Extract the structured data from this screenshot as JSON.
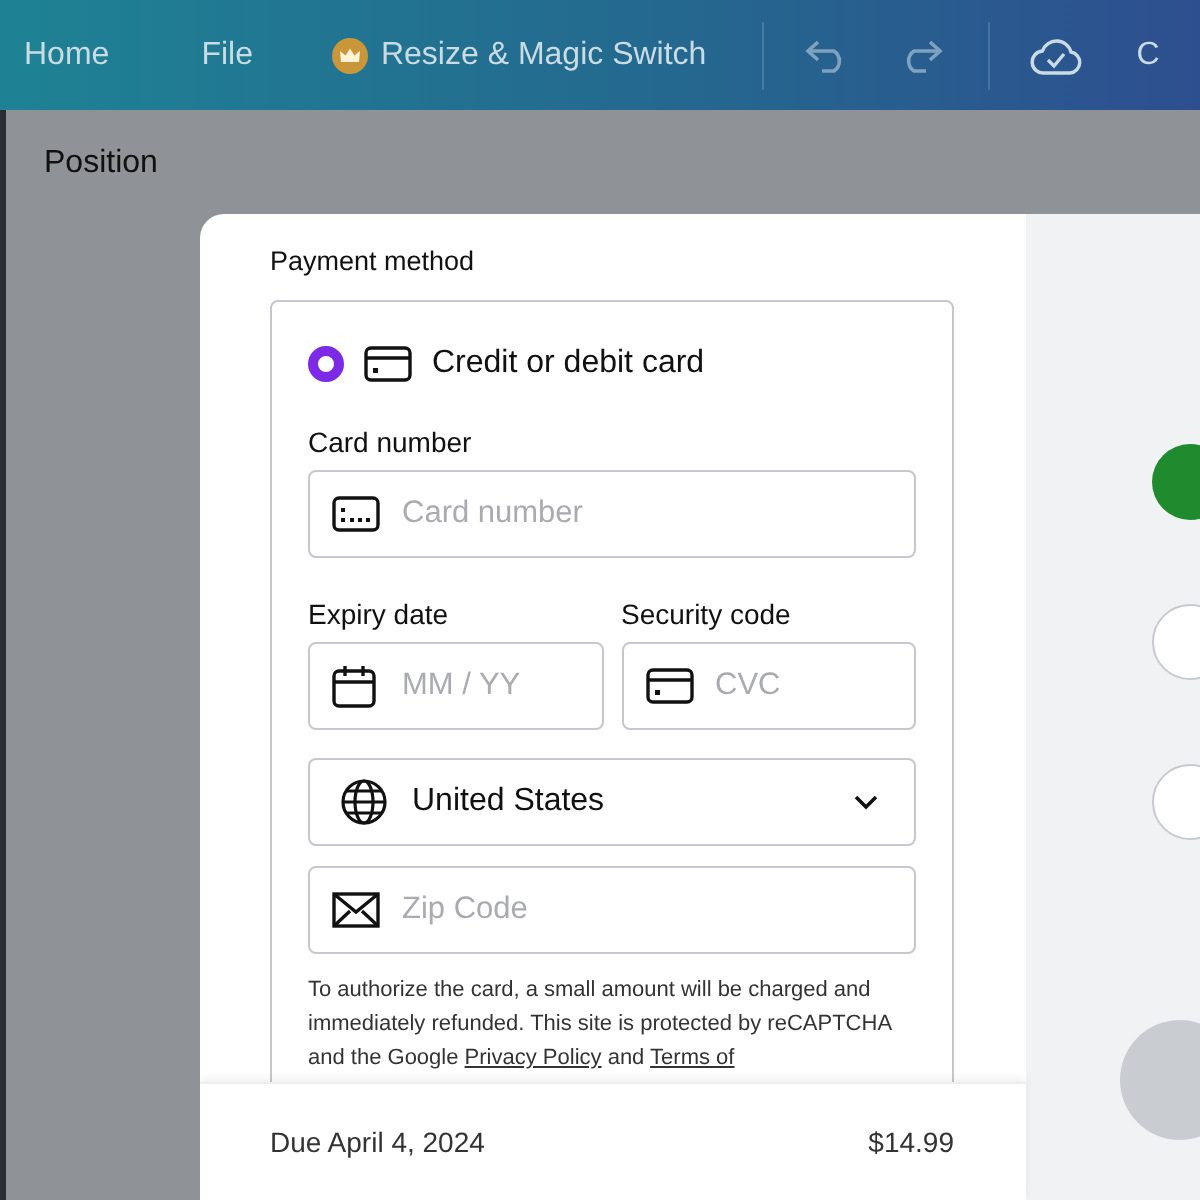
{
  "top_bar": {
    "items": [
      {
        "kind": "text",
        "label": "Home"
      },
      {
        "kind": "text",
        "label": "File"
      },
      {
        "kind": "premium",
        "label": "Resize & Magic Switch"
      },
      {
        "kind": "undo"
      },
      {
        "kind": "redo"
      },
      {
        "kind": "cloud"
      },
      {
        "kind": "text",
        "label": "C"
      }
    ]
  },
  "panel": {
    "title": "Position"
  },
  "payment": {
    "heading": "Payment method",
    "methods": [
      {
        "label": "Credit or debit card",
        "selected": true
      }
    ],
    "card_number": {
      "label": "Card number",
      "placeholder": "Card number"
    },
    "expiry": {
      "label": "Expiry date",
      "placeholder": "MM / YY"
    },
    "security": {
      "label": "Security code",
      "placeholder": "CVC"
    },
    "country": {
      "value": "United States"
    },
    "zip": {
      "placeholder": "Zip Code"
    },
    "notice": [
      {
        "kind": "text",
        "text": "To authorize the card, a small amount will be charged and immediately refunded. This site is protected by reCAPTCHA and the Google "
      },
      {
        "kind": "link",
        "text": "Privacy Policy"
      },
      {
        "kind": "text",
        "text": " and "
      },
      {
        "kind": "link",
        "text": "Terms of"
      }
    ]
  },
  "footer": {
    "due": "Due April 4, 2024",
    "amount": "$14.99"
  }
}
